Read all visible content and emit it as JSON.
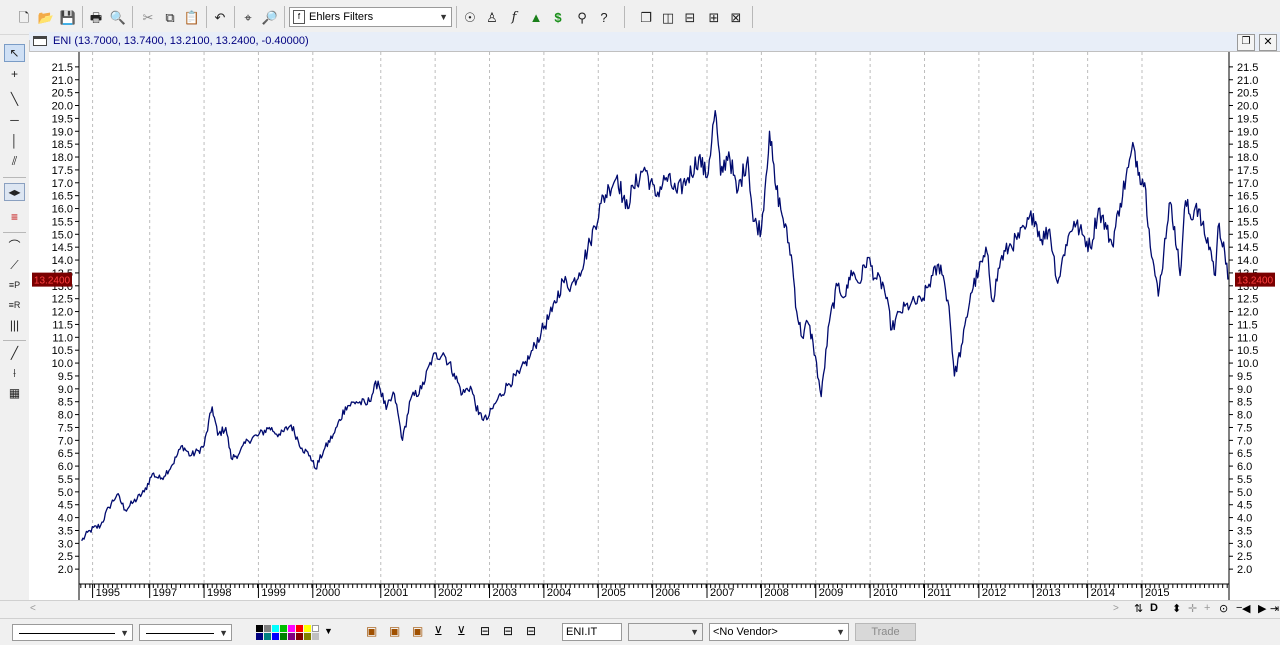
{
  "toolbar": {
    "indicator_select": "Ehlers Filters"
  },
  "chart_window": {
    "title": "ENI (13.7000, 13.7400, 13.2100, 13.2400, -0.40000)",
    "last_price_label": "13.2400"
  },
  "colors": {
    "series": "#000a6e",
    "price_badge_bg": "#7a0000",
    "price_badge_fg": "#ff4040",
    "grid": "#bdbdbd"
  },
  "chart_data": {
    "type": "line",
    "x_unit": "year",
    "xlim": [
      1994.8,
      2015.95
    ],
    "ylim": [
      1.5,
      22.0
    ],
    "y_ticks": [
      "2.0",
      "2.5",
      "3.0",
      "3.5",
      "4.0",
      "4.5",
      "5.0",
      "5.5",
      "6.0",
      "6.5",
      "7.0",
      "7.5",
      "8.0",
      "8.5",
      "9.0",
      "9.5",
      "10.0",
      "10.5",
      "11.0",
      "11.5",
      "12.0",
      "12.5",
      "13.0",
      "13.5",
      "14.0",
      "14.5",
      "15.0",
      "15.5",
      "16.0",
      "16.5",
      "17.0",
      "17.5",
      "18.0",
      "18.5",
      "19.0",
      "19.5",
      "20.0",
      "20.5",
      "21.0",
      "21.5"
    ],
    "x_ticks": [
      {
        "label": "1995",
        "x": 1995.05
      },
      {
        "label": "1997",
        "x": 1996.1
      },
      {
        "label": "1998",
        "x": 1997.1
      },
      {
        "label": "1999",
        "x": 1998.1
      },
      {
        "label": "2000",
        "x": 1999.1
      },
      {
        "label": "2001",
        "x": 2000.35
      },
      {
        "label": "2002",
        "x": 2001.35
      },
      {
        "label": "2003",
        "x": 2002.35
      },
      {
        "label": "2004",
        "x": 2003.35
      },
      {
        "label": "2005",
        "x": 2004.35
      },
      {
        "label": "2006",
        "x": 2005.35
      },
      {
        "label": "2007",
        "x": 2006.35
      },
      {
        "label": "2008",
        "x": 2007.35
      },
      {
        "label": "2009",
        "x": 2008.35
      },
      {
        "label": "2010",
        "x": 2009.35
      },
      {
        "label": "2011",
        "x": 2010.35
      },
      {
        "label": "2012",
        "x": 2011.35
      },
      {
        "label": "2013",
        "x": 2012.35
      },
      {
        "label": "2014",
        "x": 2013.35
      },
      {
        "label": "2015",
        "x": 2014.35
      }
    ],
    "series": [
      {
        "color": "#000a6e",
        "points": [
          [
            1994.85,
            3.1
          ],
          [
            1995.0,
            3.5
          ],
          [
            1995.2,
            3.7
          ],
          [
            1995.35,
            4.4
          ],
          [
            1995.5,
            4.9
          ],
          [
            1995.65,
            4.3
          ],
          [
            1995.8,
            4.6
          ],
          [
            1996.0,
            5.0
          ],
          [
            1996.15,
            5.7
          ],
          [
            1996.3,
            5.5
          ],
          [
            1996.5,
            6.0
          ],
          [
            1996.7,
            6.8
          ],
          [
            1996.85,
            6.4
          ],
          [
            1997.0,
            6.6
          ],
          [
            1997.1,
            6.8
          ],
          [
            1997.25,
            8.3
          ],
          [
            1997.35,
            7.2
          ],
          [
            1997.5,
            7.5
          ],
          [
            1997.6,
            6.3
          ],
          [
            1997.75,
            6.5
          ],
          [
            1997.9,
            7.0
          ],
          [
            1998.1,
            7.2
          ],
          [
            1998.3,
            7.5
          ],
          [
            1998.5,
            7.2
          ],
          [
            1998.7,
            7.6
          ],
          [
            1998.9,
            6.7
          ],
          [
            1999.05,
            6.4
          ],
          [
            1999.15,
            5.9
          ],
          [
            1999.3,
            6.6
          ],
          [
            1999.5,
            7.3
          ],
          [
            1999.7,
            8.3
          ],
          [
            1999.9,
            8.5
          ],
          [
            2000.1,
            8.4
          ],
          [
            2000.3,
            9.3
          ],
          [
            2000.45,
            8.2
          ],
          [
            2000.6,
            8.8
          ],
          [
            2000.75,
            7.0
          ],
          [
            2000.9,
            8.6
          ],
          [
            2001.1,
            9.0
          ],
          [
            2001.3,
            10.2
          ],
          [
            2001.5,
            10.4
          ],
          [
            2001.7,
            9.6
          ],
          [
            2001.85,
            8.8
          ],
          [
            2002.0,
            9.1
          ],
          [
            2002.15,
            8.0
          ],
          [
            2002.3,
            7.8
          ],
          [
            2002.5,
            8.6
          ],
          [
            2002.7,
            9.2
          ],
          [
            2002.9,
            9.6
          ],
          [
            2003.1,
            10.3
          ],
          [
            2003.3,
            11.2
          ],
          [
            2003.5,
            12.0
          ],
          [
            2003.7,
            13.2
          ],
          [
            2003.85,
            13.0
          ],
          [
            2004.0,
            13.5
          ],
          [
            2004.2,
            14.7
          ],
          [
            2004.4,
            16.2
          ],
          [
            2004.55,
            16.8
          ],
          [
            2004.7,
            17.3
          ],
          [
            2004.85,
            16.0
          ],
          [
            2005.0,
            16.8
          ],
          [
            2005.2,
            17.6
          ],
          [
            2005.4,
            16.5
          ],
          [
            2005.6,
            17.2
          ],
          [
            2005.8,
            16.6
          ],
          [
            2006.0,
            17.2
          ],
          [
            2006.2,
            18.0
          ],
          [
            2006.35,
            17.2
          ],
          [
            2006.5,
            19.8
          ],
          [
            2006.6,
            17.3
          ],
          [
            2006.75,
            18.2
          ],
          [
            2006.9,
            16.6
          ],
          [
            2007.1,
            18.0
          ],
          [
            2007.2,
            15.5
          ],
          [
            2007.35,
            15.2
          ],
          [
            2007.5,
            19.0
          ],
          [
            2007.6,
            17.0
          ],
          [
            2007.75,
            15.6
          ],
          [
            2007.9,
            14.2
          ],
          [
            2008.0,
            12.0
          ],
          [
            2008.1,
            11.0
          ],
          [
            2008.2,
            11.6
          ],
          [
            2008.3,
            10.8
          ],
          [
            2008.45,
            8.7
          ],
          [
            2008.6,
            11.6
          ],
          [
            2008.75,
            13.0
          ],
          [
            2008.9,
            12.6
          ],
          [
            2009.0,
            13.6
          ],
          [
            2009.15,
            13.1
          ],
          [
            2009.3,
            14.1
          ],
          [
            2009.45,
            13.3
          ],
          [
            2009.6,
            13.0
          ],
          [
            2009.75,
            11.3
          ],
          [
            2009.9,
            12.0
          ],
          [
            2010.1,
            12.3
          ],
          [
            2010.3,
            12.4
          ],
          [
            2010.5,
            13.4
          ],
          [
            2010.65,
            13.8
          ],
          [
            2010.8,
            12.2
          ],
          [
            2010.9,
            9.5
          ],
          [
            2011.05,
            10.8
          ],
          [
            2011.2,
            12.7
          ],
          [
            2011.35,
            13.6
          ],
          [
            2011.5,
            14.3
          ],
          [
            2011.6,
            12.4
          ],
          [
            2011.75,
            14.0
          ],
          [
            2011.9,
            14.5
          ],
          [
            2012.05,
            14.8
          ],
          [
            2012.2,
            15.2
          ],
          [
            2012.35,
            15.8
          ],
          [
            2012.5,
            14.8
          ],
          [
            2012.65,
            15.2
          ],
          [
            2012.8,
            13.1
          ],
          [
            2012.95,
            14.6
          ],
          [
            2013.1,
            15.5
          ],
          [
            2013.25,
            15.0
          ],
          [
            2013.4,
            14.5
          ],
          [
            2013.55,
            16.0
          ],
          [
            2013.7,
            15.2
          ],
          [
            2013.8,
            14.6
          ],
          [
            2013.95,
            16.2
          ],
          [
            2014.1,
            17.6
          ],
          [
            2014.2,
            18.4
          ],
          [
            2014.3,
            17.4
          ],
          [
            2014.4,
            17.0
          ],
          [
            2014.48,
            15.2
          ],
          [
            2014.55,
            14.0
          ],
          [
            2014.65,
            12.6
          ],
          [
            2014.75,
            14.3
          ],
          [
            2014.85,
            16.2
          ],
          [
            2014.95,
            15.3
          ],
          [
            2015.05,
            13.4
          ],
          [
            2015.15,
            16.3
          ],
          [
            2015.25,
            15.6
          ],
          [
            2015.35,
            16.2
          ],
          [
            2015.5,
            15.0
          ],
          [
            2015.6,
            14.5
          ],
          [
            2015.7,
            13.4
          ],
          [
            2015.75,
            15.3
          ],
          [
            2015.85,
            14.7
          ],
          [
            2015.93,
            13.24
          ]
        ]
      }
    ]
  },
  "bottom_bar": {
    "symbol": "ENI.IT",
    "vendor": "<No Vendor>",
    "trade_label": "Trade"
  }
}
